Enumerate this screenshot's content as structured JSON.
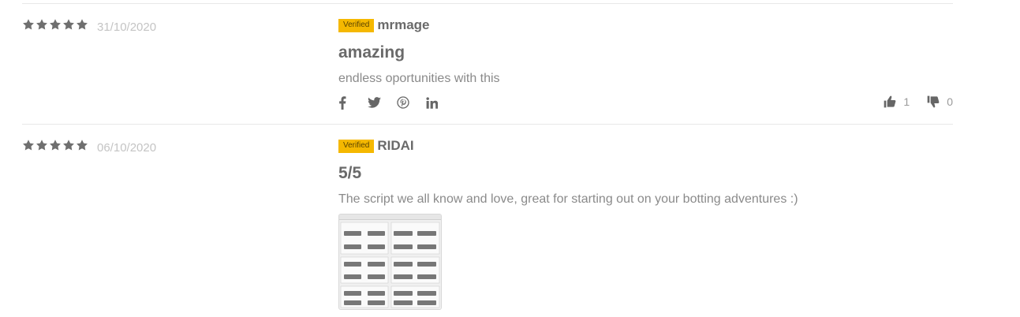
{
  "reviews": [
    {
      "rating": 5,
      "date": "31/10/2020",
      "verified_label": "Verified",
      "author": "mrmage",
      "title": "amazing",
      "body": "endless oportunities with this",
      "share_icons": [
        "facebook-icon",
        "twitter-icon",
        "pinterest-icon",
        "linkedin-icon"
      ],
      "upvotes": "1",
      "downvotes": "0"
    },
    {
      "rating": 5,
      "date": "06/10/2020",
      "verified_label": "Verified",
      "author": "RIDAI",
      "title": "5/5",
      "body": "The script we all know and love, great for starting out on your botting adventures :)",
      "attachment": "screenshot-thumbnail"
    }
  ],
  "colors": {
    "star": "#6f6f6f",
    "badge": "#f5b800",
    "divider": "#e8e8e8"
  }
}
